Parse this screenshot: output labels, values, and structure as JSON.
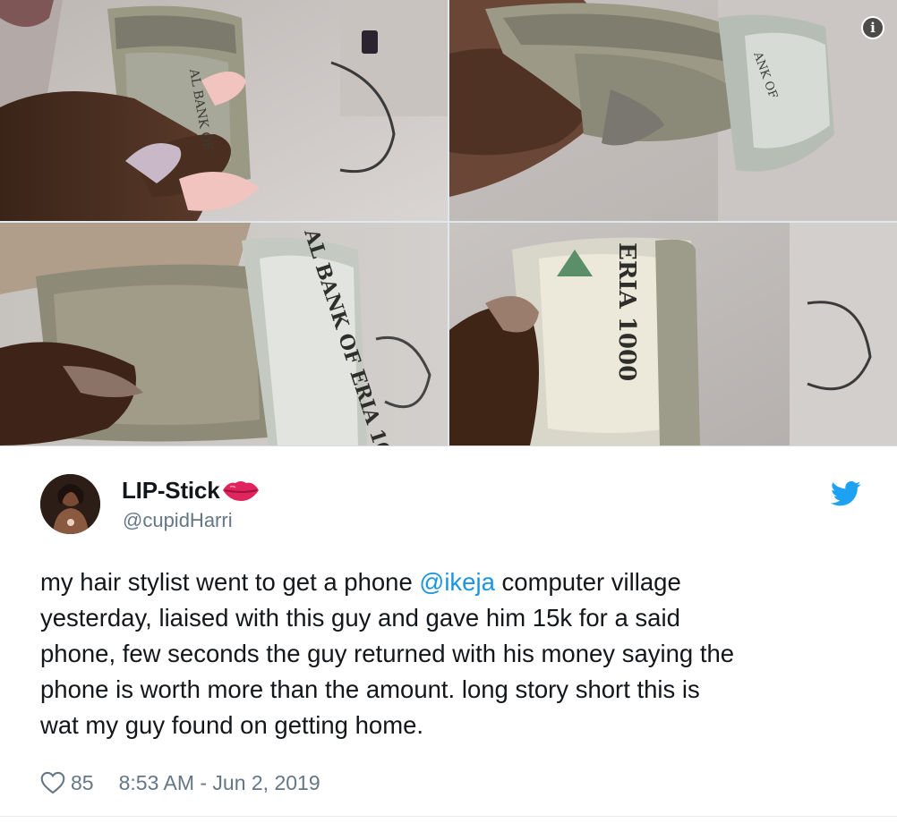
{
  "media": {
    "photos": [
      {
        "description_icon": "photo-money-folded-1"
      },
      {
        "description_icon": "photo-money-folded-2"
      },
      {
        "description_icon": "photo-money-folded-3"
      },
      {
        "description_icon": "photo-money-folded-4"
      }
    ],
    "info_badge": "i",
    "note_texts": {
      "p1": "AL BANK OF",
      "p2": "ANK OF",
      "p3": "AL BANK OF ERIA 10",
      "p4": "ERIA 1000"
    }
  },
  "tweet": {
    "display_name": "LIP-Stick",
    "handle": "@cupidHarri",
    "text_before_mention": "my hair stylist went to get a phone ",
    "mention": "@ikeja",
    "text_after_mention": " computer village\nyesterday, liaised with this guy and gave him 15k for a said\nphone, few seconds the guy returned with his money saying the\nphone is worth more than the amount. long story short this is\nwat my guy found on getting home.",
    "like_count": "85",
    "timestamp": "8:53 AM - Jun 2, 2019"
  },
  "icons": {
    "lips": "lips-icon",
    "twitter": "twitter-bird-icon",
    "heart": "heart-icon",
    "info": "info-icon"
  },
  "colors": {
    "mention": "#1b95e0",
    "twitter_blue": "#1da1f2",
    "muted": "#657786",
    "lips_red": "#e0245e"
  }
}
